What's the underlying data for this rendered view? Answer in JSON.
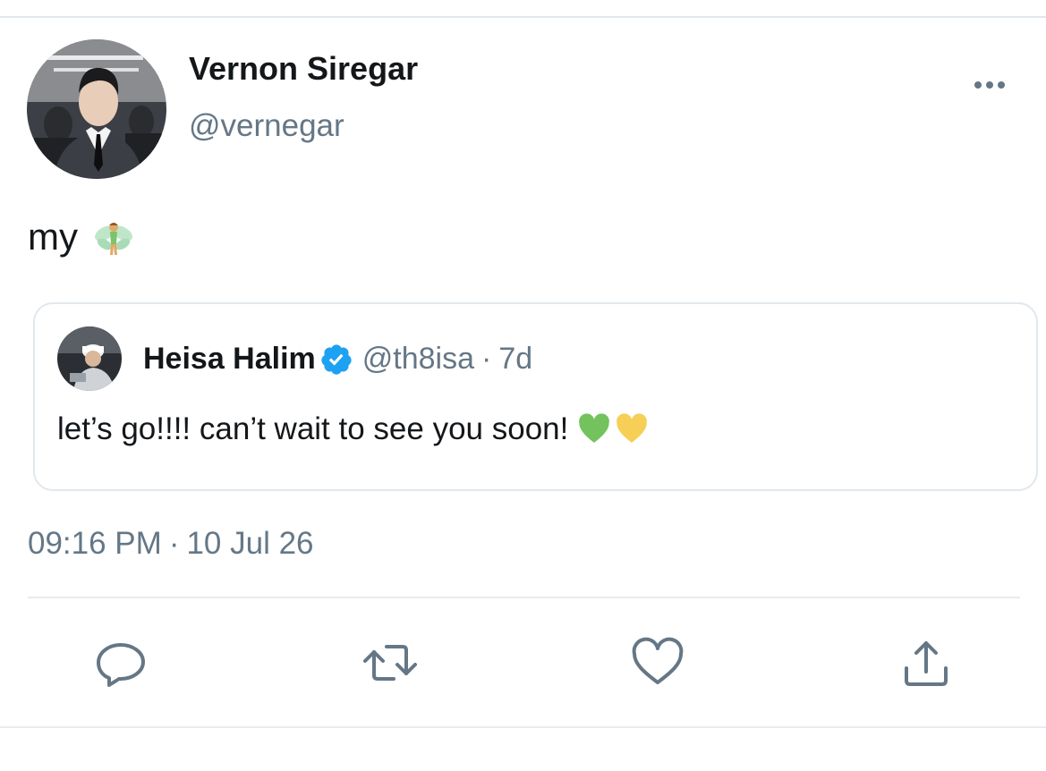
{
  "tweet": {
    "author": {
      "display_name": "Vernon Siregar",
      "handle": "@vernegar",
      "avatar": "profile-photo"
    },
    "more_icon": "ellipsis-icon",
    "text": "my",
    "text_emoji": "fairy-emoji",
    "quoted_tweet": {
      "author_name": "Heisa Halim",
      "verified": true,
      "verified_icon": "verified-badge-icon",
      "handle": "@th8isa",
      "separator": "·",
      "time_ago": "7d",
      "text": "let’s go!!!! can’t wait to see you soon!",
      "emojis": [
        "green-heart-emoji",
        "yellow-heart-emoji"
      ]
    },
    "timestamp": {
      "time": "09:16 PM",
      "separator": "·",
      "date": "10 Jul 26"
    },
    "actions": [
      {
        "name": "reply",
        "icon": "reply-icon"
      },
      {
        "name": "retweet",
        "icon": "retweet-icon"
      },
      {
        "name": "like",
        "icon": "heart-icon"
      },
      {
        "name": "share",
        "icon": "share-icon"
      }
    ]
  },
  "colors": {
    "primary_text": "#14171a",
    "secondary_text": "#657786",
    "icon": "#657786",
    "divider": "#e6ecf0",
    "verified_blue": "#1da1f2"
  }
}
